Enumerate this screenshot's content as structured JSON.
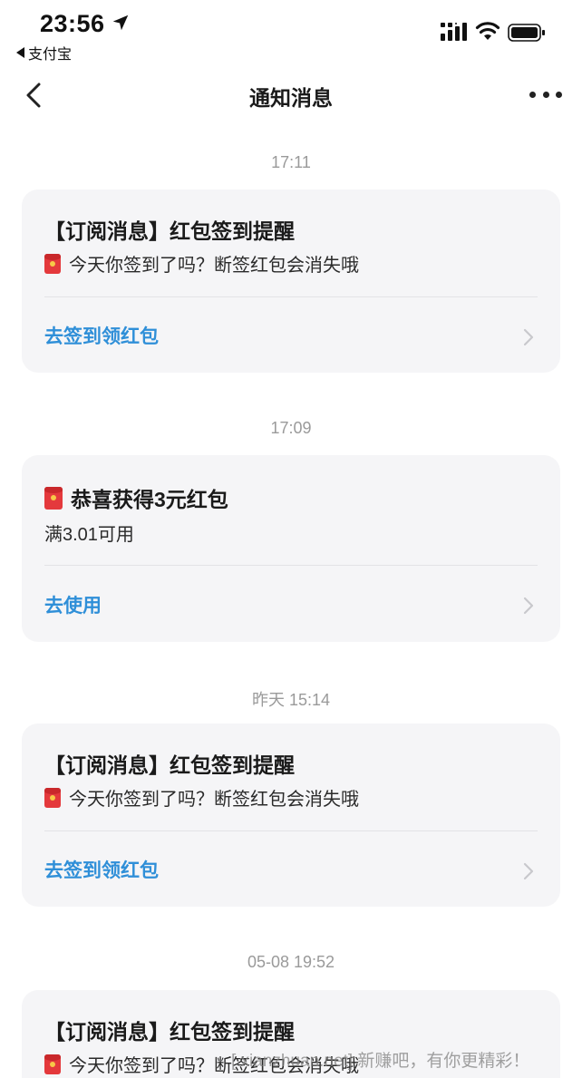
{
  "status_bar": {
    "time": "23:56",
    "back_app_label": "支付宝"
  },
  "nav": {
    "title": "通知消息"
  },
  "feed": [
    {
      "time": "17:11",
      "title": "【订阅消息】红包签到提醒",
      "body": "今天你签到了吗？断签红包会消失哦",
      "action": "去签到领红包"
    },
    {
      "time": "17:09",
      "title": "恭喜获得3元红包",
      "body": "满3.01可用",
      "action": "去使用"
    },
    {
      "time": "昨天 15:14",
      "title": "【订阅消息】红包签到提醒",
      "body": "今天你签到了吗？断签红包会消失哦",
      "action": "去签到领红包"
    },
    {
      "time": "05-08 19:52",
      "title": "【订阅消息】红包签到提醒",
      "body": "今天你签到了吗？断签红包会消失哦"
    }
  ],
  "watermark": "[ xianzhuan.net] 新赚吧，有你更精彩！",
  "colors": {
    "accent": "#2f8fd8",
    "card_bg": "#f5f5f7",
    "time_label": "#9a9a9a",
    "red_packet": "#e4393c"
  }
}
